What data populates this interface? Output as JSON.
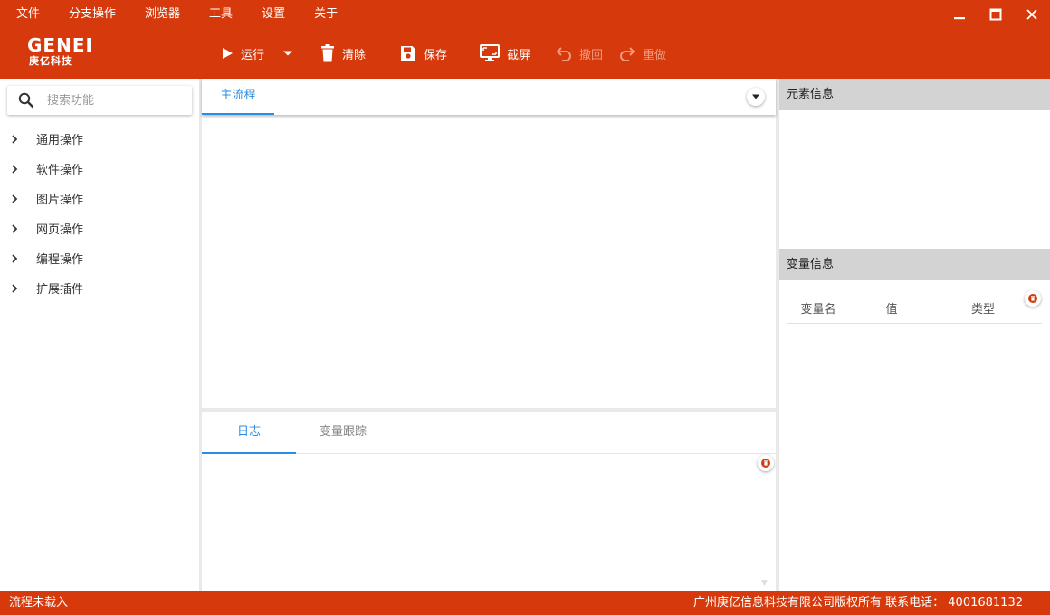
{
  "menu": [
    "文件",
    "分支操作",
    "浏览器",
    "工具",
    "设置",
    "关于"
  ],
  "logo": {
    "main": "GENEI",
    "sub": "庚亿科技"
  },
  "toolbar": {
    "run": "运行",
    "clear": "清除",
    "save": "保存",
    "screenshot": "截屏",
    "undo": "撤回",
    "redo": "重做"
  },
  "search": {
    "placeholder": "搜索功能"
  },
  "tree": [
    "通用操作",
    "软件操作",
    "图片操作",
    "网页操作",
    "编程操作",
    "扩展插件"
  ],
  "flow": {
    "tab": "主流程"
  },
  "log": {
    "tabs": [
      "日志",
      "变量跟踪"
    ]
  },
  "right": {
    "element_info": "元素信息",
    "variable_info": "变量信息",
    "columns": [
      "变量名",
      "值",
      "类型"
    ]
  },
  "status": {
    "left": "流程未载入",
    "right": "广州庚亿信息科技有限公司版权所有  联系电话： 4001681132"
  },
  "colors": {
    "brand": "#d6390b",
    "accent": "#2b8de0"
  }
}
